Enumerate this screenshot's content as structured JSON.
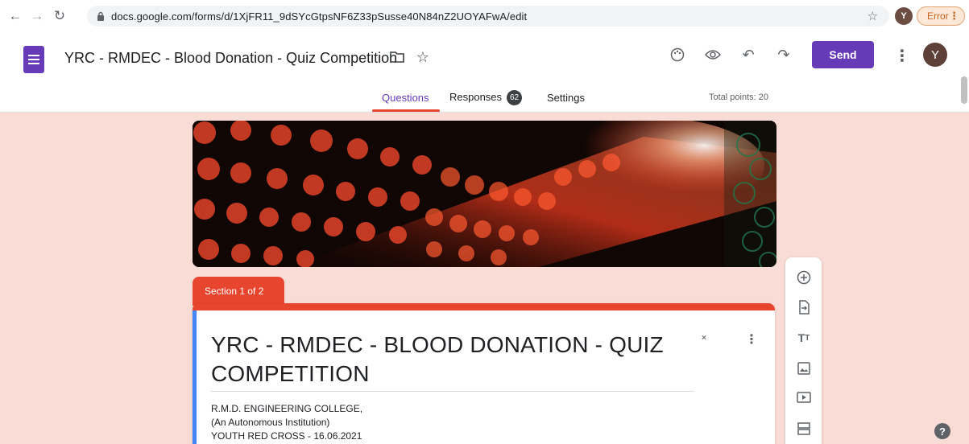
{
  "browser": {
    "url": "docs.google.com/forms/d/1XjFR11_9dSYcGtpsNF6Z33pSusse40N84nZ2UOYAFwA/edit",
    "profile_initial": "Y",
    "error_label": "Error"
  },
  "header": {
    "form_title": "YRC - RMDEC - Blood Donation - Quiz Competition",
    "send_label": "Send",
    "avatar_initial": "Y"
  },
  "tabs": {
    "questions": "Questions",
    "responses": "Responses",
    "responses_count": "62",
    "settings": "Settings",
    "total_points": "Total points: 20"
  },
  "section": {
    "label": "Section 1 of 2"
  },
  "card": {
    "title": "YRC - RMDEC - BLOOD DONATION - QUIZ COMPETITION",
    "description": [
      "R.M.D. ENGINEERING COLLEGE,",
      "(An Autonomous Institution)",
      "YOUTH RED CROSS - 16.06.2021"
    ]
  },
  "colors": {
    "accent": "#673ab7",
    "theme": "#e8452e",
    "background": "#fadcd6"
  },
  "icons": [
    "back-icon",
    "forward-icon",
    "reload-icon",
    "lock-icon",
    "star-icon",
    "forms-logo-icon",
    "folder-icon",
    "palette-icon",
    "eye-icon",
    "undo-icon",
    "redo-icon",
    "more-vert-icon",
    "add-question-icon",
    "import-questions-icon",
    "title-text-icon",
    "image-icon",
    "video-icon",
    "section-icon",
    "collapse-icon",
    "help-icon"
  ]
}
